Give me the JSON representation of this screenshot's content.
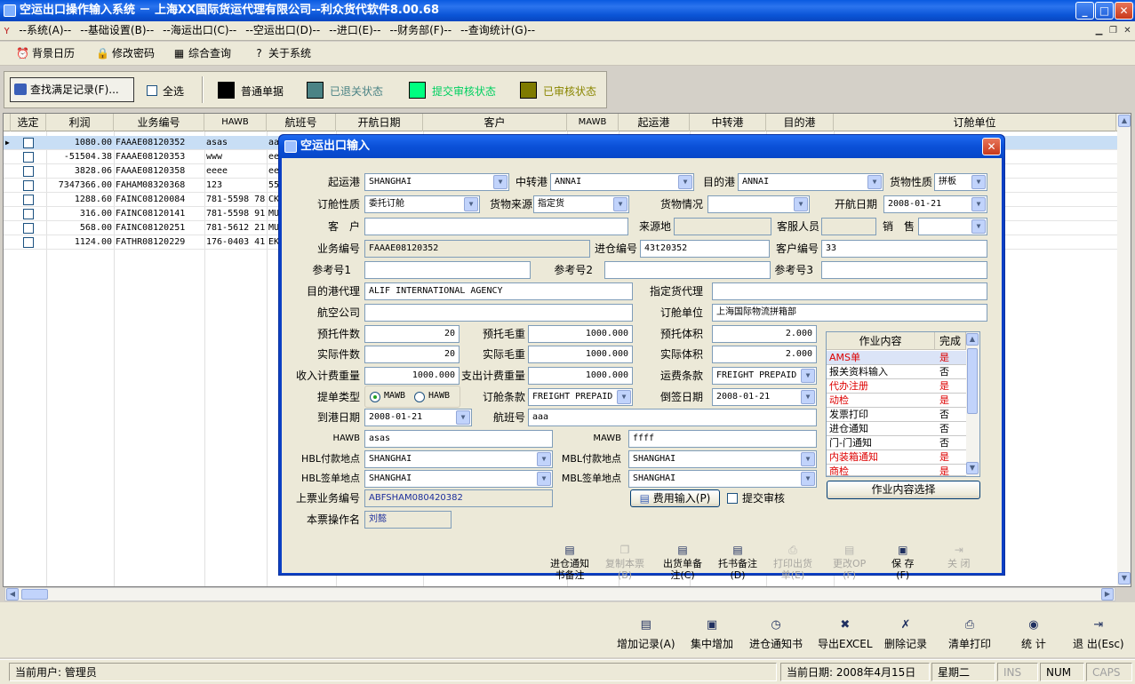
{
  "window": {
    "title": "空运出口操作输入系统 － 上海XX国际货运代理有限公司--利众货代软件8.00.68"
  },
  "menu": [
    "--系统(A)--",
    "--基础设置(B)--",
    "--海运出口(C)--",
    "--空运出口(D)--",
    "--进口(E)--",
    "--财务部(F)--",
    "--查询统计(G)--"
  ],
  "toolbar": {
    "calendar": "背景日历",
    "password": "修改密码",
    "query": "综合查询",
    "about": "关于系统"
  },
  "filter": {
    "find_label": "查找满足记录(F)...",
    "select_all": "全选",
    "legend": [
      {
        "label": "普通单据",
        "color": "#000000"
      },
      {
        "label": "已退关状态",
        "color": "#4b8385"
      },
      {
        "label": "提交审核状态",
        "color": "#00ff80"
      },
      {
        "label": "已审核状态",
        "color": "#7f7b00"
      }
    ]
  },
  "grid": {
    "headers": [
      "选定",
      "利润",
      "业务编号",
      "HAWB",
      "航班号",
      "开航日期",
      "客户",
      "MAWB",
      "起运港",
      "中转港",
      "目的港",
      "订舱单位"
    ],
    "rows": [
      {
        "profit": "1080.00",
        "no": "FAAAE08120352",
        "hawb": "asas",
        "flight": "aa"
      },
      {
        "profit": "-51504.38",
        "no": "FAAAE08120353",
        "hawb": "www",
        "flight": "ee"
      },
      {
        "profit": "3828.06",
        "no": "FAAAE08120358",
        "hawb": "eeee",
        "flight": "ee"
      },
      {
        "profit": "7347366.00",
        "no": "FAHAM08320368",
        "hawb": "123",
        "flight": "55"
      },
      {
        "profit": "1288.60",
        "no": "FAINC08120084",
        "hawb": "781-5598 78",
        "flight": "CK"
      },
      {
        "profit": "316.00",
        "no": "FAINC08120141",
        "hawb": "781-5598 91",
        "flight": "MU"
      },
      {
        "profit": "568.00",
        "no": "FAINC08120251",
        "hawb": "781-5612 21",
        "flight": "MU"
      },
      {
        "profit": "1124.00",
        "no": "FATHR08120229",
        "hawb": "176-0403 41",
        "flight": "EK"
      }
    ]
  },
  "dialog": {
    "title": "空运出口输入",
    "labels": {
      "origin": "起运港",
      "transit": "中转港",
      "dest": "目的港",
      "cargo_nature": "货物性质",
      "booking_nature": "订舱性质",
      "cargo_source": "货物来源",
      "cargo_status": "货物情况",
      "sail_date": "开航日期",
      "customer": "客　户",
      "source": "来源地",
      "service": "客服人员",
      "sales": "销　售",
      "biz_no": "业务编号",
      "warehouse_no": "进仓编号",
      "customer_no": "客户编号",
      "ref1": "参考号1",
      "ref2": "参考号2",
      "ref3": "参考号3",
      "dest_agent": "目的港代理",
      "designated_agent": "指定货代理",
      "airline": "航空公司",
      "booking_unit": "订舱单位",
      "pre_pieces": "预托件数",
      "pre_weight": "预托毛重",
      "pre_volume": "预托体积",
      "act_pieces": "实际件数",
      "act_weight": "实际毛重",
      "act_volume": "实际体积",
      "income_weight": "收入计费重量",
      "expense_weight": "支出计费重量",
      "freight_terms": "运费条款",
      "bill_type": "提单类型",
      "booking_terms": "订舱条款",
      "backdate": "倒签日期",
      "arrival_date": "到港日期",
      "flight": "航班号",
      "hawb": "HAWB",
      "mawb": "MAWB",
      "hbl_pay": "HBL付款地点",
      "mbl_pay": "MBL付款地点",
      "hbl_issue": "HBL签单地点",
      "mbl_issue": "MBL签单地点",
      "prev_no": "上票业务编号",
      "operator": "本票操作名"
    },
    "values": {
      "origin": "SHANGHAI",
      "transit": "ANNAI",
      "dest": "ANNAI",
      "cargo_nature": "拼板",
      "booking_nature": "委托订舱",
      "cargo_source": "指定货",
      "cargo_status": "",
      "sail_date": "2008-01-21",
      "customer": "",
      "source": "",
      "service": "",
      "sales": "",
      "biz_no": "FAAAE08120352",
      "warehouse_no": "43t20352",
      "customer_no": "33",
      "ref1": "",
      "ref2": "",
      "ref3": "",
      "dest_agent": "ALIF INTERNATIONAL AGENCY",
      "designated_agent": "",
      "airline": "",
      "booking_unit": "上海国际物流拼箱部",
      "pre_pieces": "20",
      "pre_weight": "1000.000",
      "pre_volume": "2.000",
      "act_pieces": "20",
      "act_weight": "1000.000",
      "act_volume": "2.000",
      "income_weight": "1000.000",
      "expense_weight": "1000.000",
      "freight_terms": "FREIGHT PREPAID",
      "bill_mawb": "MAWB",
      "bill_hawb": "HAWB",
      "booking_terms": "FREIGHT PREPAID",
      "backdate": "2008-01-21",
      "arrival_date": "2008-01-21",
      "flight": "aaa",
      "hawb": "asas",
      "mawb": "ffff",
      "hbl_pay": "SHANGHAI",
      "mbl_pay": "SHANGHAI",
      "hbl_issue": "SHANGHAI",
      "mbl_issue": "SHANGHAI",
      "prev_no": "ABFSHAM080420382",
      "operator": "刘懿"
    },
    "tasks": {
      "header_name": "作业内容",
      "header_done": "完成",
      "items": [
        {
          "name": "AMS单",
          "done": "是",
          "red": true
        },
        {
          "name": "报关资料输入",
          "done": "否",
          "red": false
        },
        {
          "name": "代办注册",
          "done": "是",
          "red": true
        },
        {
          "name": "动检",
          "done": "是",
          "red": true
        },
        {
          "name": "发票打印",
          "done": "否",
          "red": false
        },
        {
          "name": "进仓通知",
          "done": "否",
          "red": false
        },
        {
          "name": "门-门通知",
          "done": "否",
          "red": false
        },
        {
          "name": "内装箱通知",
          "done": "是",
          "red": true
        },
        {
          "name": "商检",
          "done": "是",
          "red": true
        }
      ],
      "select_btn": "作业内容选择"
    },
    "fee_btn": "费用输入(P)",
    "submit_review": "提交审核",
    "actions": [
      {
        "l1": "进仓通知",
        "l2": "书备注",
        "enabled": true
      },
      {
        "l1": "复制本票",
        "l2": "(B)",
        "enabled": false
      },
      {
        "l1": "出货单备",
        "l2": "注(C)",
        "enabled": true
      },
      {
        "l1": "托书备注",
        "l2": "(D)",
        "enabled": true
      },
      {
        "l1": "打印出货",
        "l2": "单(E)",
        "enabled": false
      },
      {
        "l1": "更改OP",
        "l2": "(F)",
        "enabled": false
      },
      {
        "l1": "保 存",
        "l2": "(F)",
        "enabled": true
      },
      {
        "l1": "关 闭",
        "l2": "",
        "enabled": false
      }
    ]
  },
  "bottom": [
    "增加记录(A)",
    "集中增加",
    "进仓通知书",
    "导出EXCEL",
    "删除记录",
    "清单打印",
    "统 计",
    "退 出(Esc)"
  ],
  "status": {
    "user": "当前用户: 管理员",
    "date": "当前日期: 2008年4月15日",
    "weekday": "星期二",
    "ins": "INS",
    "num": "NUM",
    "caps": "CAPS"
  }
}
